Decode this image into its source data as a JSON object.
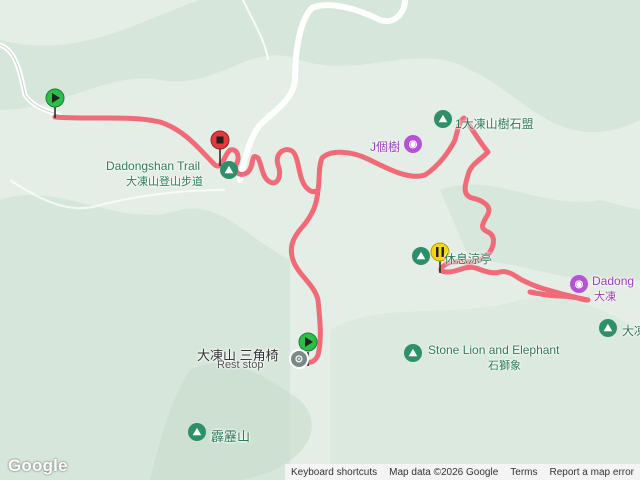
{
  "map": {
    "labels": {
      "dadongshan_trail": "Dadongshan Trail",
      "dadongshan_trail_zh": "大凍山登山步道",
      "tree_stone": "1大凍山樹石盟",
      "tree_photo": "J個樹",
      "rest_pavilion": "休息涼亭",
      "dadong_right": "Dadong",
      "dadong_right_zh": "大凍",
      "triangulation": "大凍山 三角椅",
      "rest_stop": "Rest stop",
      "stone_lion": "Stone Lion and Elephant",
      "stone_lion_zh": "石獅象",
      "thunder_mountain": "霹靂山",
      "right_edge": "大凍"
    },
    "icons": {
      "hiker": "hiker-icon",
      "camera": "camera-icon",
      "rest": "rest-stop-icon"
    },
    "colors": {
      "track": "#f06a78",
      "start_pin": "#2bbf4a",
      "end_pin": "#e0393e",
      "waypoint_pin": "#f4d80f",
      "terrain": "#e4eee6"
    }
  },
  "attribution": {
    "logo": "Google",
    "keyboard": "Keyboard shortcuts",
    "map_data": "Map data ©2026 Google",
    "terms": "Terms",
    "report": "Report a map error"
  }
}
